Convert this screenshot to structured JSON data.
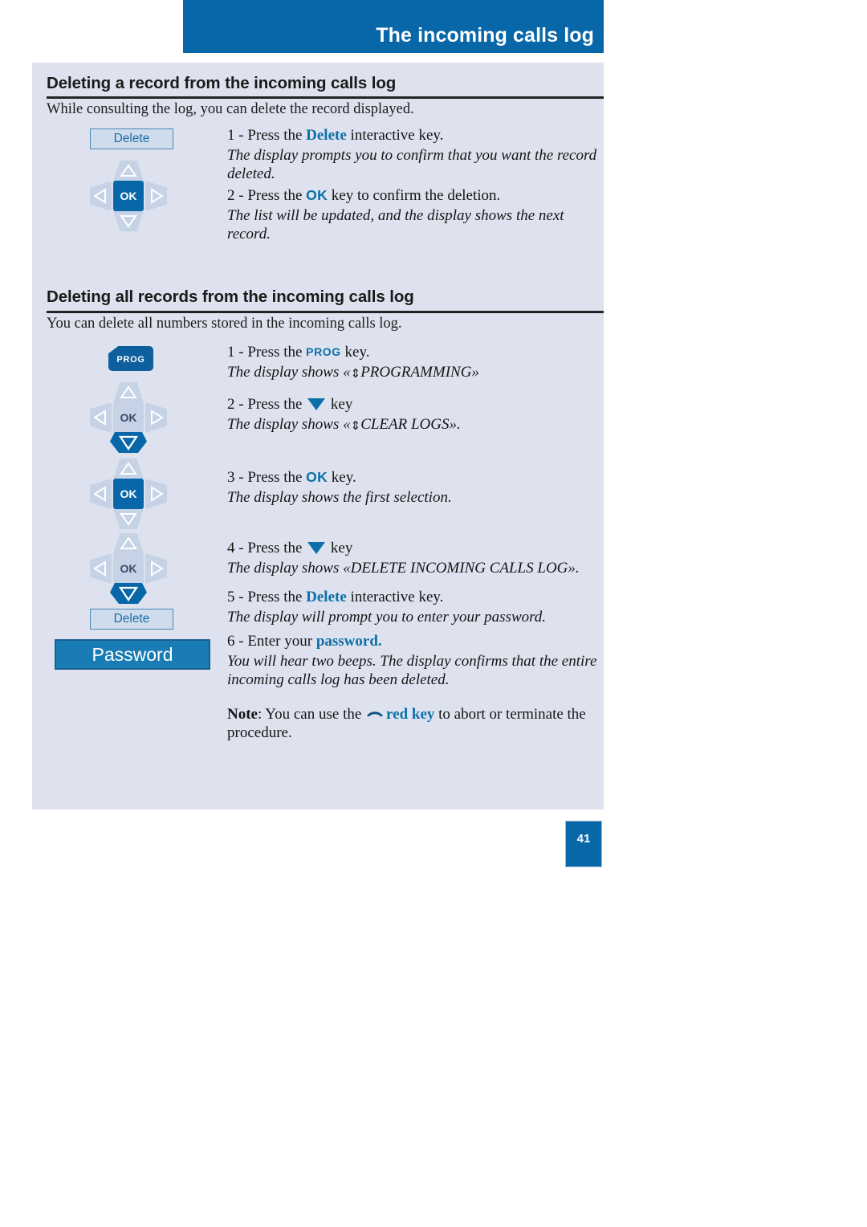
{
  "header": {
    "title": "The incoming calls log"
  },
  "sections": [
    {
      "heading": "Deleting a record from the incoming calls log",
      "intro": "While consulting the log, you can delete the record displayed.",
      "steps": [
        {
          "number": "1 - ",
          "lead": "Press the ",
          "key": "Delete",
          "tail": " interactive key.",
          "note": "The display prompts you to confirm that you want the record deleted."
        },
        {
          "number": "2 - ",
          "lead": "Press the ",
          "key": "OK",
          "tail": " key to confirm the deletion.",
          "note": "The list will be updated, and the display shows the next record."
        }
      ]
    },
    {
      "heading": "Deleting all records from the incoming calls log",
      "intro": "You can delete all numbers stored in the incoming calls log.",
      "steps": [
        {
          "number": "1 - ",
          "lead": "Press the ",
          "key": "PROG",
          "tail": " key.",
          "note_pre": "The display shows «",
          "note_arrow": "⇕",
          "note_post": "PROGRAMMING»"
        },
        {
          "number": "2 - ",
          "lead": "Press the ",
          "key": "",
          "tail": " key",
          "note_pre": "The display shows «",
          "note_arrow": "⇕",
          "note_post": "CLEAR LOGS»."
        },
        {
          "number": "3 - ",
          "lead": "Press the ",
          "key": "OK",
          "tail": " key.",
          "note": "The display shows the first selection."
        },
        {
          "number": "4 - ",
          "lead": "Press the ",
          "key": "",
          "tail": " key",
          "note": "The display shows «DELETE INCOMING CALLS LOG»."
        },
        {
          "number": "5 - ",
          "lead": "Press the ",
          "key": "Delete",
          "tail": " interactive key.",
          "note": "The display will prompt you to enter your password."
        },
        {
          "number": "6 - ",
          "lead": "Enter your ",
          "key": "password.",
          "tail": "",
          "note": "You will hear two beeps. The display confirms that the entire incoming calls log has been deleted."
        }
      ],
      "note": {
        "label": "Note",
        "lead": ": You can use the ",
        "key": "red key",
        "tail": " to abort or terminate the procedure."
      }
    }
  ],
  "keys": {
    "delete_label": "Delete",
    "prog_label": "PROG",
    "ok_label": "OK",
    "password_label": "Password"
  },
  "page_number": "41",
  "colors": {
    "header_blue": "#0767a8",
    "panel_bg": "#dde2ee",
    "accent_blue": "#0d6fa8",
    "pad_gray": "#c6d2e6",
    "password_blue": "#1a7cb4"
  }
}
